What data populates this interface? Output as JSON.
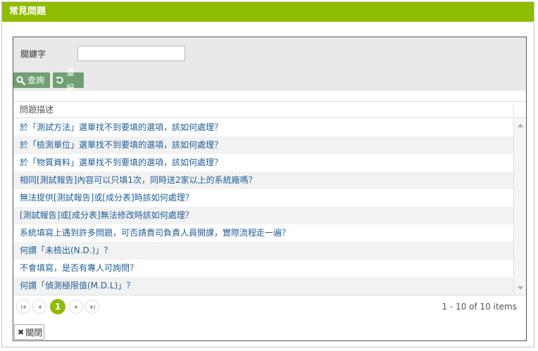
{
  "window": {
    "title": "常見問題"
  },
  "search": {
    "keyword_label": "關鍵字",
    "keyword_value": "",
    "query_label": "查詢",
    "reset_label": "重設"
  },
  "grid": {
    "column_header": "問題描述",
    "rows": [
      "於「測試方法」選單找不到要填的選項，該如何處理？",
      "於「檢測單位」選單找不到要填的選項，該如何處理？",
      "於「物質資料」選單找不到要填的選項，該如何處理？",
      "相同[測試報告]內容可以只填1次，同時送2家以上的系統廠嗎？",
      "無法提供[測試報告]或[成分表]時該如何處理？",
      "[測試報告]或[成分表]無法修改時該如何處理？",
      "系統填寫上遇到許多問題，可否請貴司負責人員開課，實際流程走一遍？",
      "何謂「未檢出(N.D.)」？",
      "不會填寫，是否有專人可詢問？",
      "何謂「偵測極限值(M.D.L)」？"
    ]
  },
  "pager": {
    "current_page": "1",
    "info": "1 - 10 of 10 items"
  },
  "footer": {
    "close_label": "關閉"
  },
  "colors": {
    "accent": "#8ebc00",
    "button": "#6f9f73",
    "link": "#1f5d99"
  }
}
